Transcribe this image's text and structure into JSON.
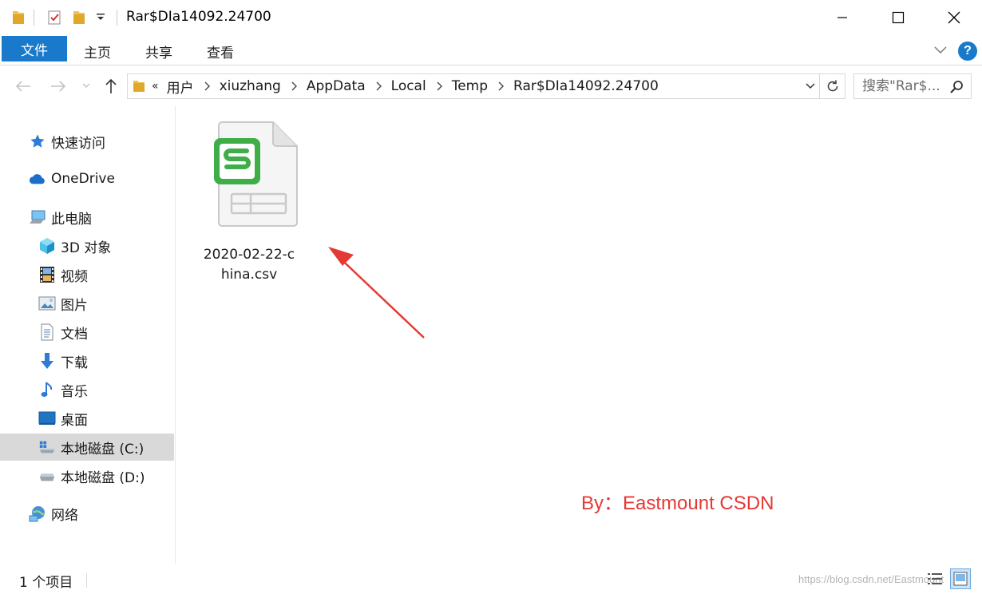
{
  "window": {
    "title": "Rar$DIa14092.24700"
  },
  "ribbon": {
    "tabs": [
      {
        "label": "文件"
      },
      {
        "label": "主页"
      },
      {
        "label": "共享"
      },
      {
        "label": "查看"
      }
    ],
    "help_label": "?"
  },
  "address": {
    "overflow": "«",
    "crumbs": [
      "用户",
      "xiuzhang",
      "AppData",
      "Local",
      "Temp",
      "Rar$DIa14092.24700"
    ]
  },
  "search": {
    "placeholder": "搜索\"Rar$..."
  },
  "sidebar": {
    "items": [
      {
        "label": "快速访问",
        "icon": "star-icon"
      },
      {
        "label": "OneDrive",
        "icon": "cloud-icon"
      },
      {
        "label": "此电脑",
        "icon": "computer-icon"
      },
      {
        "label": "3D 对象",
        "icon": "cube-icon"
      },
      {
        "label": "视频",
        "icon": "film-icon"
      },
      {
        "label": "图片",
        "icon": "picture-icon"
      },
      {
        "label": "文档",
        "icon": "document-icon"
      },
      {
        "label": "下载",
        "icon": "download-icon"
      },
      {
        "label": "音乐",
        "icon": "music-icon"
      },
      {
        "label": "桌面",
        "icon": "desktop-icon"
      },
      {
        "label": "本地磁盘 (C:)",
        "icon": "drive-c-icon",
        "selected": true
      },
      {
        "label": "本地磁盘 (D:)",
        "icon": "drive-d-icon"
      },
      {
        "label": "网络",
        "icon": "network-icon"
      }
    ]
  },
  "files": [
    {
      "name": "2020-02-22-china.csv",
      "icon": "spreadsheet-icon"
    }
  ],
  "annotation": {
    "text": "By：Eastmount CSDN",
    "color": "#e53935"
  },
  "status": {
    "count": "1 个项目",
    "site": "https://blog.csdn.net/Eastmount"
  },
  "colors": {
    "accent": "#1979ca",
    "selection": "#d9d9d9",
    "csv_green": "#3fae49"
  }
}
